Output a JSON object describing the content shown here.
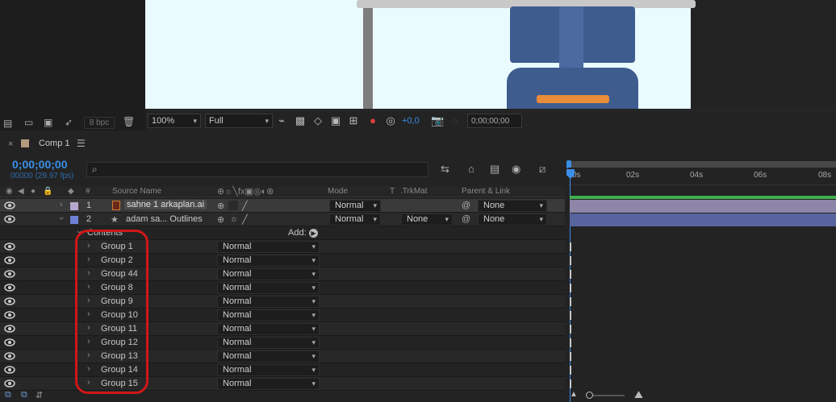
{
  "project": {
    "bpc": "8 bpc"
  },
  "viewer_toolbar": {
    "zoom": "100%",
    "resolution": "Full",
    "exposure": "+0,0",
    "timecode": "0;00;00;00"
  },
  "timeline": {
    "comp_tab": "Comp 1",
    "current_time": "0;00;00;00",
    "frames": "00000 (29.97 fps)",
    "headers": {
      "number": "#",
      "source_name": "Source Name",
      "mode": "Mode",
      "t": "T",
      "trkmat": ".TrkMat",
      "parent": "Parent & Link"
    },
    "ruler": [
      "0s",
      "02s",
      "04s",
      "06s",
      "08s"
    ],
    "contents_label": "Contents",
    "add_label": "Add:",
    "layers": [
      {
        "num": "1",
        "name": "sahne 1 arkaplan.ai",
        "mode": "Normal",
        "parent": "None",
        "color": "#b6a7cf"
      },
      {
        "num": "2",
        "name": "adam sa... Outlines",
        "mode": "Normal",
        "trkmat": "None",
        "parent": "None",
        "color": "#6f7fd8"
      }
    ],
    "groups": [
      {
        "name": "Group 1",
        "mode": "Normal"
      },
      {
        "name": "Group 2",
        "mode": "Normal"
      },
      {
        "name": "Group 44",
        "mode": "Normal"
      },
      {
        "name": "Group 8",
        "mode": "Normal"
      },
      {
        "name": "Group 9",
        "mode": "Normal"
      },
      {
        "name": "Group 10",
        "mode": "Normal"
      },
      {
        "name": "Group 11",
        "mode": "Normal"
      },
      {
        "name": "Group 12",
        "mode": "Normal"
      },
      {
        "name": "Group 13",
        "mode": "Normal"
      },
      {
        "name": "Group 14",
        "mode": "Normal"
      },
      {
        "name": "Group 15",
        "mode": "Normal"
      }
    ]
  }
}
